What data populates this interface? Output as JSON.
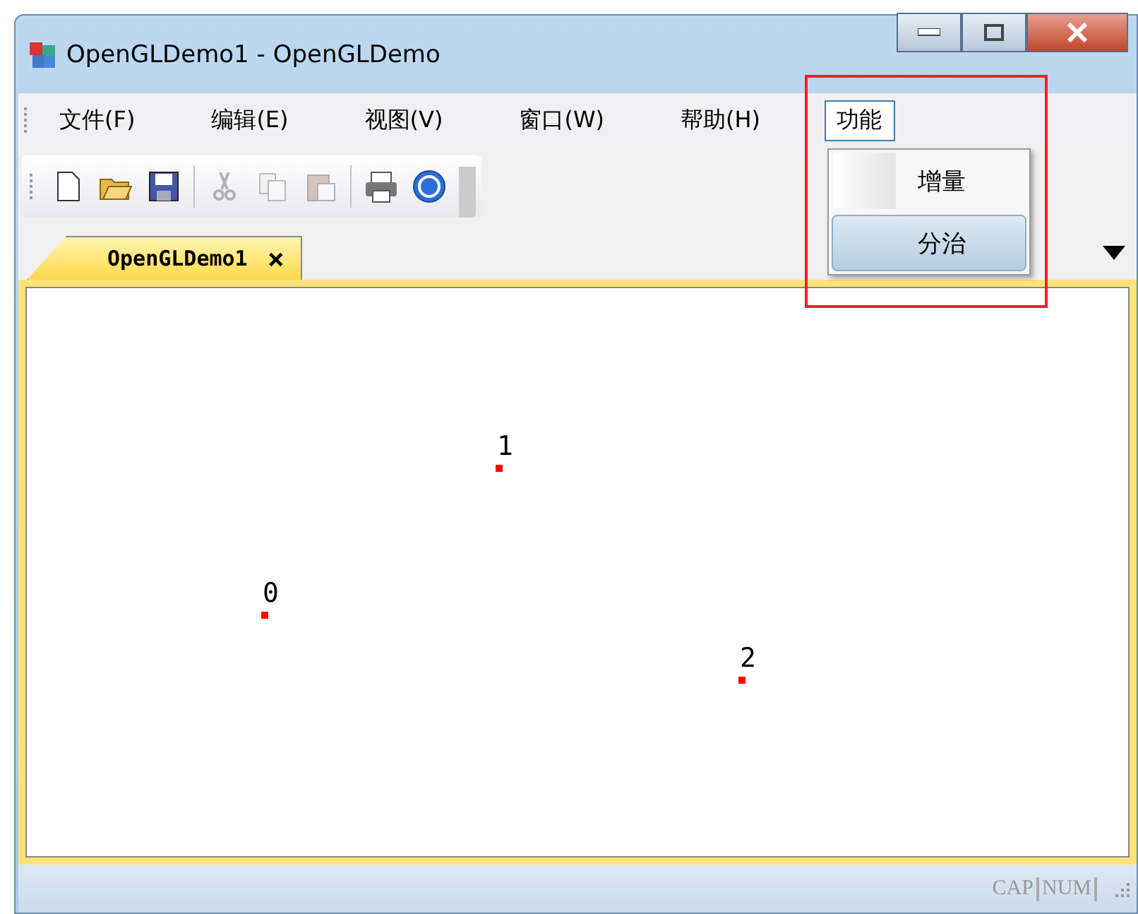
{
  "window": {
    "title": "OpenGLDemo1 - OpenGLDemo"
  },
  "menu_bar": [
    {
      "label": "文件(F)",
      "selected": false
    },
    {
      "label": "编辑(E)",
      "selected": false
    },
    {
      "label": "视图(V)",
      "selected": false
    },
    {
      "label": "窗口(W)",
      "selected": false
    },
    {
      "label": "帮助(H)",
      "selected": false
    },
    {
      "label": "功能",
      "selected": true
    }
  ],
  "dropdown": {
    "items": [
      {
        "label": "增量",
        "selected": false
      },
      {
        "label": "分治",
        "selected": true
      }
    ]
  },
  "toolbar": [
    {
      "kind": "new",
      "disabled": false
    },
    {
      "kind": "open",
      "disabled": false
    },
    {
      "kind": "save",
      "disabled": false
    },
    {
      "kind": "sep"
    },
    {
      "kind": "cut",
      "disabled": true
    },
    {
      "kind": "copy",
      "disabled": true
    },
    {
      "kind": "paste",
      "disabled": true
    },
    {
      "kind": "sep"
    },
    {
      "kind": "print",
      "disabled": false
    },
    {
      "kind": "help",
      "disabled": false
    }
  ],
  "tabs": [
    {
      "label": "OpenGLDemo1",
      "selected": true,
      "close": "×"
    }
  ],
  "canvas": {
    "points": [
      {
        "label": "0"
      },
      {
        "label": "1"
      },
      {
        "label": "2"
      }
    ]
  },
  "status_bar": [
    "CAP",
    "NUM"
  ]
}
